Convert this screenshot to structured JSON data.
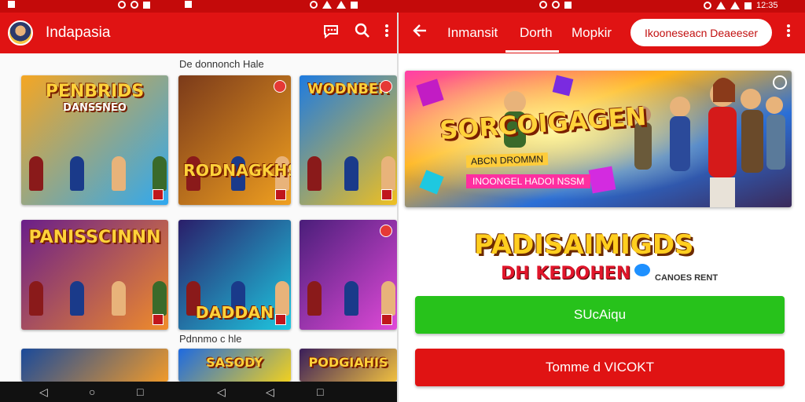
{
  "status": {
    "left_time": "",
    "mid_time": "",
    "right_time": "12:35"
  },
  "left": {
    "app_title": "Indapasia",
    "icons": [
      "chat-icon",
      "search-icon",
      "more-vert-icon"
    ],
    "section_top": "De donnonch Hale",
    "section_bottom": "Pdnnmo c hle",
    "tiles": [
      {
        "title": "PENBRIDS",
        "subtitle": "DANSSNEO",
        "colors": [
          "#f5a623",
          "#2fa8f0"
        ]
      },
      {
        "title": "RODNAGKHS",
        "subtitle": "",
        "colors": [
          "#7b3a1a",
          "#f0a020"
        ]
      },
      {
        "title": "WODNBER",
        "subtitle": "",
        "colors": [
          "#1e7be0",
          "#f0c020"
        ]
      },
      {
        "title": "PANISSCINNN",
        "subtitle": "",
        "colors": [
          "#6a1e8a",
          "#f08c2a"
        ]
      },
      {
        "title": "DADDAN",
        "subtitle": "",
        "colors": [
          "#2a1e6a",
          "#1ec8e0"
        ]
      },
      {
        "title": "",
        "subtitle": "",
        "colors": [
          "#4a1e7a",
          "#e04ad8"
        ]
      },
      {
        "title": "",
        "subtitle": "",
        "colors": [
          "#1a4a9a",
          "#f09a2a"
        ]
      },
      {
        "title": "SASODY",
        "subtitle": "",
        "colors": [
          "#1e6ae0",
          "#f0d020"
        ]
      },
      {
        "title": "PODGIAHIS",
        "subtitle": "",
        "colors": [
          "#3a1e5a",
          "#f0c040"
        ]
      }
    ]
  },
  "right": {
    "tabs": [
      "Inmansit",
      "Dorth",
      "Mopkir"
    ],
    "active_tab": 1,
    "pill_label": "Ikooneseacn Deaeeser",
    "banner": {
      "title": "SORCOIGAGEN",
      "subtitle": "ABCN DROMMN",
      "strip": "INOONGEL HADOI NSSM"
    },
    "logo": {
      "title": "PADISAIMIGDS",
      "subtitle": "DH KEDOHEN",
      "tag": "CANOES RENT"
    },
    "primary_button": "SUcAiqu",
    "secondary_button": "Tomme d VICOKT"
  },
  "colors": {
    "brand_red": "#e01313",
    "status_red": "#c40a0a",
    "green": "#27c21b"
  }
}
